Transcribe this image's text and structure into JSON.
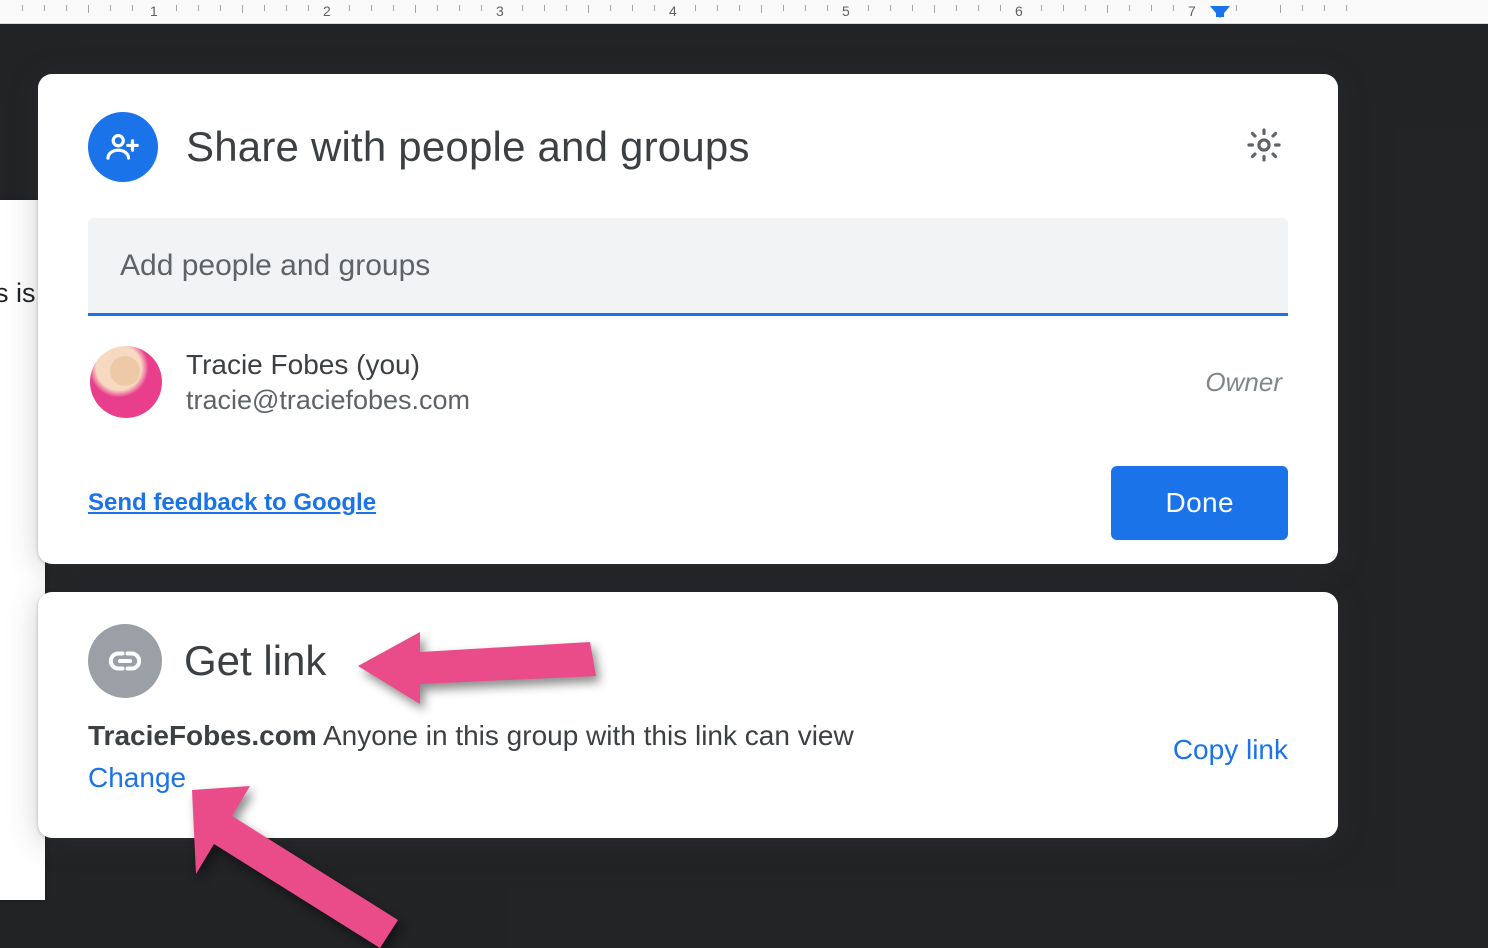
{
  "ruler": {
    "numbers": [
      "1",
      "2",
      "3",
      "4",
      "5",
      "6",
      "7"
    ]
  },
  "page_peek_text": "s is",
  "share": {
    "title": "Share with people and groups",
    "input_placeholder": "Add people and groups",
    "owner": {
      "name": "Tracie Fobes (you)",
      "email": "tracie@traciefobes.com",
      "role": "Owner"
    },
    "feedback_label": "Send feedback to Google",
    "done_label": "Done"
  },
  "link": {
    "title": "Get link",
    "domain": "TracieFobes.com",
    "description_rest": " Anyone in this group with this link can view",
    "change_label": "Change",
    "copy_label": "Copy link"
  }
}
